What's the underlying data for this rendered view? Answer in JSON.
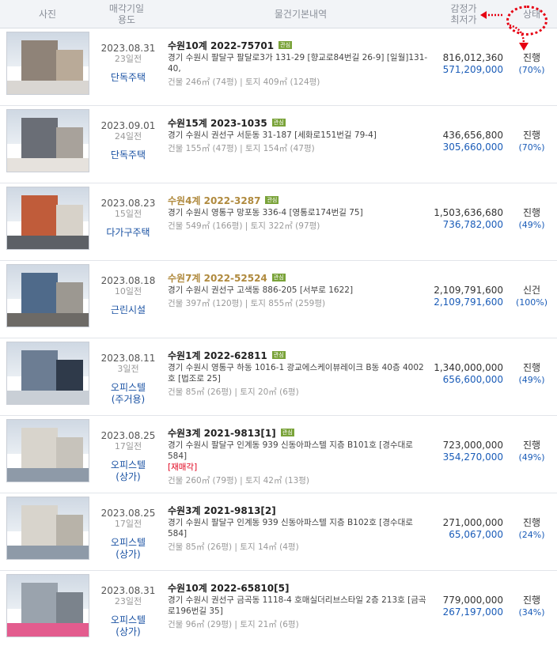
{
  "header": {
    "photo": "사진",
    "date_line1": "매각기일",
    "date_line2": "용도",
    "info": "물건기본내역",
    "price_line1": "감정가",
    "price_line2": "최저가",
    "status": "상태"
  },
  "colors": {
    "header_bg": "#f2f4f7",
    "link_blue": "#1a52a3",
    "min_price_blue": "#1a5cb8",
    "badge_green": "#7aa33a",
    "annotation_red": "#e60012",
    "reauction_red": "#e0001b"
  },
  "rows": [
    {
      "date": "2023.08.31",
      "days": "23일전",
      "ptype1": "단독주택",
      "ptype2": "",
      "case": "수원10계 2022-75701",
      "case_gold": false,
      "badge": "관심",
      "addr": "경기 수원시 팔달구 팔달로3가 131-29 [향교로84번길 26-9] [일월]131-40,",
      "re": "",
      "area": "건물 246㎡ (74평)  |  토지 409㎡ (124평)",
      "appraisal": "816,012,360",
      "minimum": "571,209,000",
      "status": "진행",
      "percent": "(70%)"
    },
    {
      "date": "2023.09.01",
      "days": "24일전",
      "ptype1": "단독주택",
      "ptype2": "",
      "case": "수원15계 2023-1035",
      "case_gold": false,
      "badge": "관심",
      "addr": "경기 수원시 권선구 서둔동 31-187 [세화로151번길 79-4]",
      "re": "",
      "area": "건물 155㎡ (47평)  |  토지 154㎡ (47평)",
      "appraisal": "436,656,800",
      "minimum": "305,660,000",
      "status": "진행",
      "percent": "(70%)"
    },
    {
      "date": "2023.08.23",
      "days": "15일전",
      "ptype1": "다가구주택",
      "ptype2": "",
      "case": "수원4계 2022-3287",
      "case_gold": true,
      "badge": "관심",
      "addr": "경기 수원시 영통구 망포동 336-4 [영통로174번길 75]",
      "re": "",
      "area": "건물 549㎡ (166평)  |  토지 322㎡ (97평)",
      "appraisal": "1,503,636,680",
      "minimum": "736,782,000",
      "status": "진행",
      "percent": "(49%)"
    },
    {
      "date": "2023.08.18",
      "days": "10일전",
      "ptype1": "근린시설",
      "ptype2": "",
      "case": "수원7계 2022-52524",
      "case_gold": true,
      "badge": "관심",
      "addr": "경기 수원시 권선구 고색동 886-205 [서부로 1622]",
      "re": "",
      "area": "건물 397㎡ (120평)  |  토지 855㎡ (259평)",
      "appraisal": "2,109,791,600",
      "minimum": "2,109,791,600",
      "status": "신건",
      "percent": "(100%)"
    },
    {
      "date": "2023.08.11",
      "days": "3일전",
      "ptype1": "오피스텔",
      "ptype2": "(주거용)",
      "case": "수원1계 2022-62811",
      "case_gold": false,
      "badge": "관심",
      "addr": "경기 수원시 영통구 하동 1016-1 광교에스케이뷰레이크 B동 40층 4002호 [법조로 25]",
      "re": "",
      "area": "건물 85㎡ (26평)  |  토지 20㎡ (6평)",
      "appraisal": "1,340,000,000",
      "minimum": "656,600,000",
      "status": "진행",
      "percent": "(49%)"
    },
    {
      "date": "2023.08.25",
      "days": "17일전",
      "ptype1": "오피스텔",
      "ptype2": "(상가)",
      "case": "수원3계 2021-9813[1]",
      "case_gold": false,
      "badge": "관심",
      "addr": "경기 수원시 팔달구 인계동 939 신동아파스텔 지층 B101호 [경수대로 584]",
      "re": "[재매각]",
      "area": "건물 260㎡ (79평)  |  토지 42㎡ (13평)",
      "appraisal": "723,000,000",
      "minimum": "354,270,000",
      "status": "진행",
      "percent": "(49%)"
    },
    {
      "date": "2023.08.25",
      "days": "17일전",
      "ptype1": "오피스텔",
      "ptype2": "(상가)",
      "case": "수원3계 2021-9813[2]",
      "case_gold": false,
      "badge": "",
      "addr": "경기 수원시 팔달구 인계동 939 신동아파스텔 지층 B102호 [경수대로 584]",
      "re": "",
      "area": "건물 85㎡ (26평)  |  토지 14㎡ (4평)",
      "appraisal": "271,000,000",
      "minimum": "65,067,000",
      "status": "진행",
      "percent": "(24%)"
    },
    {
      "date": "2023.08.31",
      "days": "23일전",
      "ptype1": "오피스텔",
      "ptype2": "(상가)",
      "case": "수원10계 2022-65810[5]",
      "case_gold": false,
      "badge": "",
      "addr": "경기 수원시 권선구 금곡동 1118-4 호매실더리브스타일 2층 213호 [금곡로196번길 35]",
      "re": "",
      "area": "건물 96㎡ (29평)  |  토지 21㎡ (6평)",
      "appraisal": "779,000,000",
      "minimum": "267,197,000",
      "status": "진행",
      "percent": "(34%)"
    }
  ]
}
